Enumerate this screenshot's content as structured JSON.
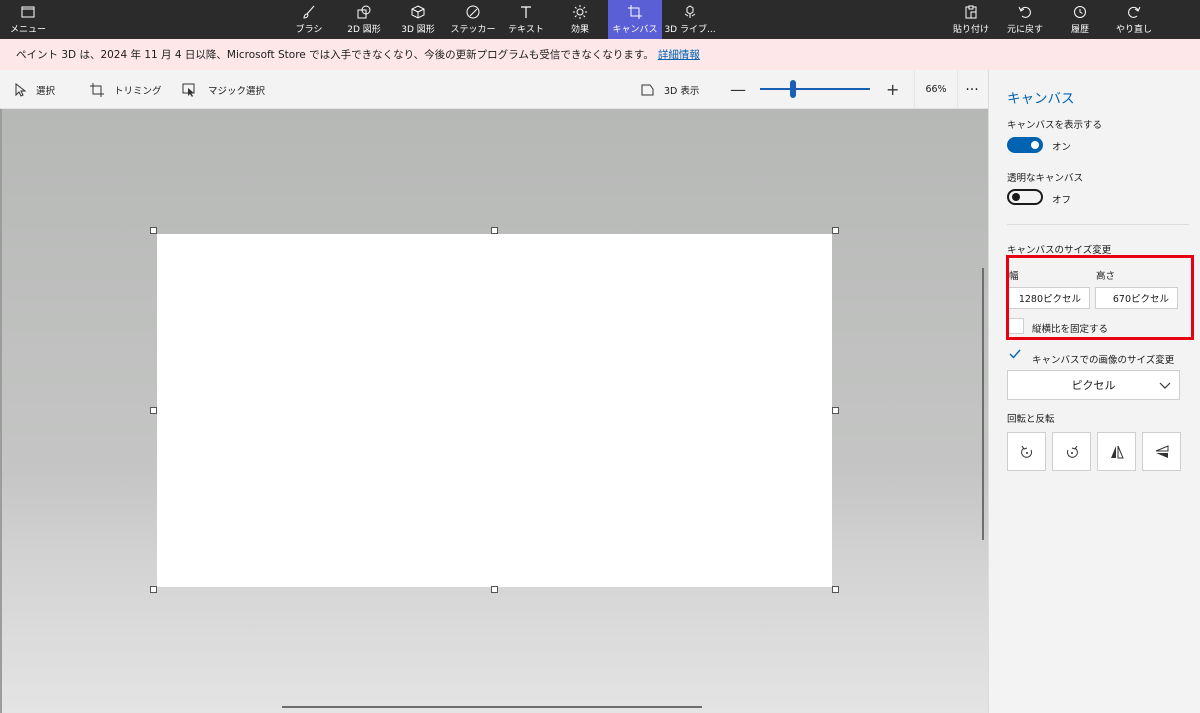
{
  "topbar": {
    "menu": "メニュー",
    "tools": [
      {
        "label": "ブラシ",
        "icon": "brush-icon"
      },
      {
        "label": "2D 図形",
        "icon": "2d-shapes-icon"
      },
      {
        "label": "3D 図形",
        "icon": "3d-shapes-icon"
      },
      {
        "label": "ステッカー",
        "icon": "sticker-icon"
      },
      {
        "label": "テキスト",
        "icon": "text-icon"
      },
      {
        "label": "効果",
        "icon": "effects-icon"
      },
      {
        "label": "キャンバス",
        "icon": "canvas-icon",
        "active": true
      },
      {
        "label": "3D ライブ...",
        "icon": "3d-library-icon"
      }
    ],
    "actions": [
      {
        "label": "貼り付け",
        "icon": "paste-icon"
      },
      {
        "label": "元に戻す",
        "icon": "undo-icon"
      },
      {
        "label": "履歴",
        "icon": "history-icon"
      },
      {
        "label": "やり直し",
        "icon": "redo-icon"
      }
    ]
  },
  "banner": {
    "text": "ペイント 3D は、2024 年 11 月 4 日以降、Microsoft Store では入手できなくなり、今後の更新プログラムも受信できなくなります。",
    "link": "詳細情報"
  },
  "subbar": {
    "select": "選択",
    "crop": "トリミング",
    "magic_select": "マジック選択",
    "view3d": "3D 表示",
    "zoom_minus": "—",
    "zoom_plus": "+",
    "zoom_percent": "66%",
    "zoom_level": 0.3,
    "more": "···"
  },
  "panel": {
    "title": "キャンバス",
    "show_canvas_label": "キャンバスを表示する",
    "show_canvas_state": "オン",
    "transparent_label": "透明なキャンバス",
    "transparent_state": "オフ",
    "resize_label": "キャンバスのサイズ変更",
    "width_label": "幅",
    "height_label": "高さ",
    "width_value": "1280ピクセル",
    "height_value": "670ピクセル",
    "lock_aspect": "縦横比を固定する",
    "resize_image": "キャンバスでの画像のサイズ変更",
    "unit": "ピクセル",
    "rotate_flip_label": "回転と反転"
  },
  "colors": {
    "accent": "#0063b1",
    "active_tool": "#5a5fd6",
    "highlight": "#e60012"
  }
}
